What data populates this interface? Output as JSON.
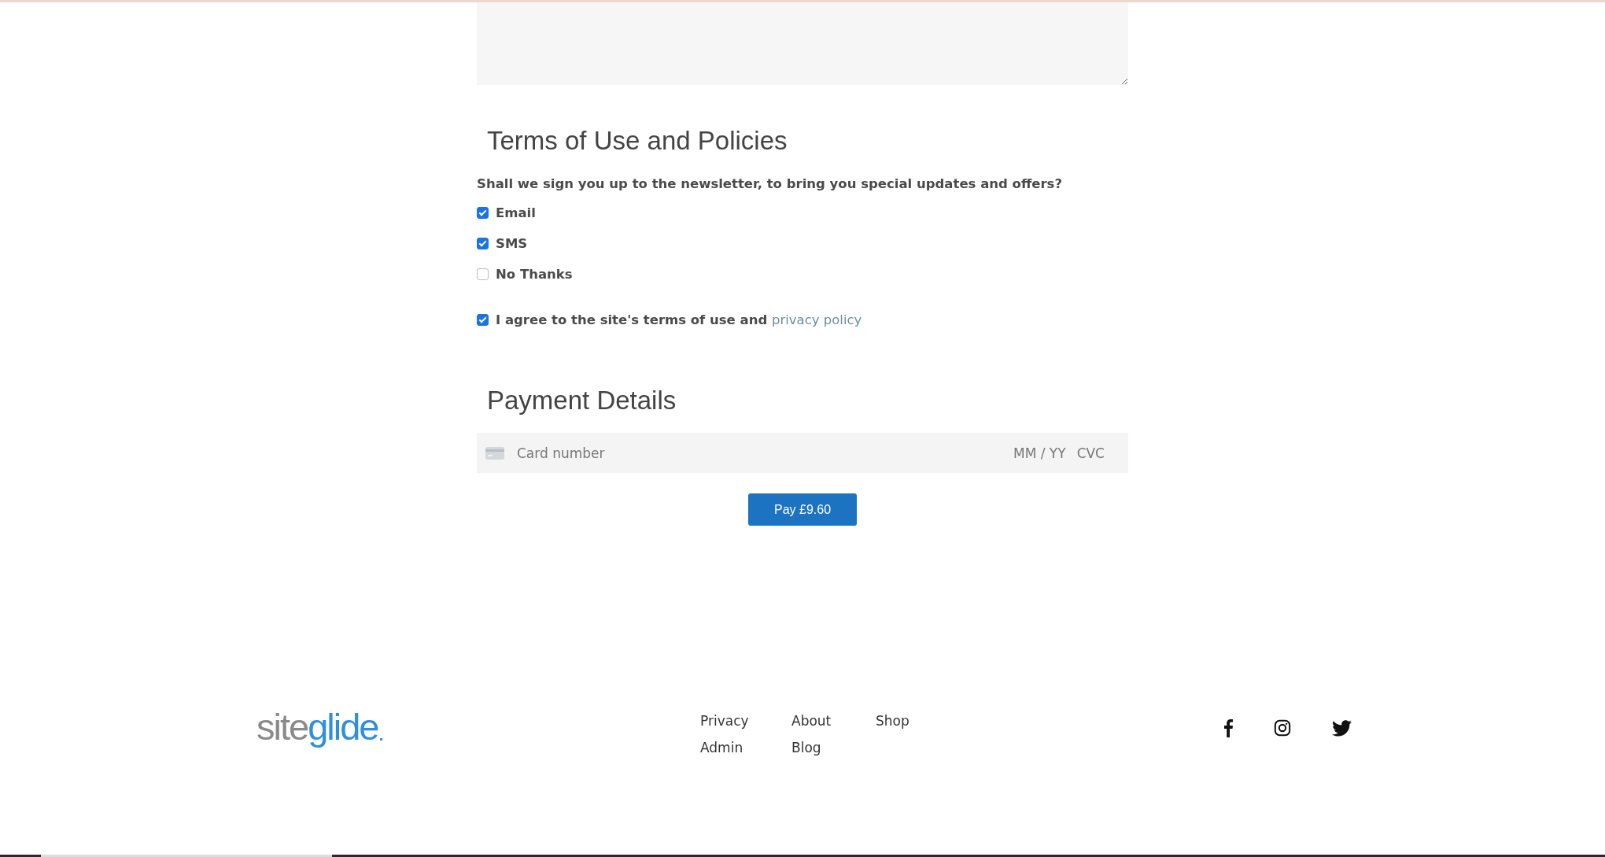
{
  "terms": {
    "title": "Terms of Use and Policies",
    "question": "Shall we sign you up to the newsletter, to bring you special updates and offers?",
    "options": [
      {
        "label": "Email",
        "checked": true
      },
      {
        "label": "SMS",
        "checked": true
      },
      {
        "label": "No Thanks",
        "checked": false
      }
    ],
    "agree": {
      "text": "I agree to the site's terms of use and",
      "link": "privacy policy",
      "checked": true
    }
  },
  "payment": {
    "title": "Payment Details",
    "card_placeholder": "Card number",
    "expiry_placeholder": "MM / YY",
    "cvc_placeholder": "CVC",
    "pay_button": "Pay £9.60"
  },
  "footer": {
    "logo": {
      "prefix": "site",
      "suffix": "glide"
    },
    "links": [
      "Privacy",
      "About",
      "Shop",
      "Admin",
      "Blog"
    ]
  }
}
